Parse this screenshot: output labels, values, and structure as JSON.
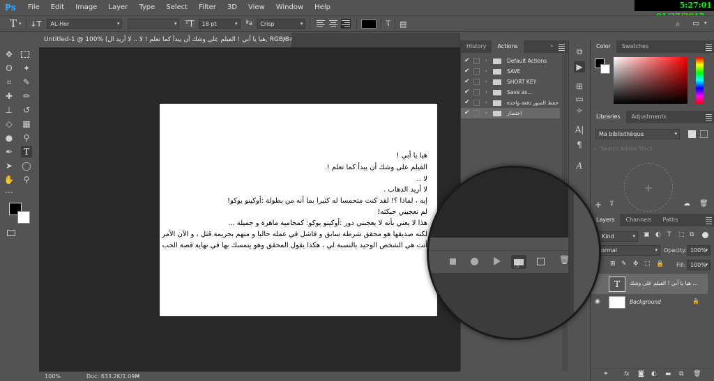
{
  "app": {
    "logo": "Ps"
  },
  "menu": [
    "File",
    "Edit",
    "Image",
    "Layer",
    "Type",
    "Select",
    "Filter",
    "3D",
    "View",
    "Window",
    "Help"
  ],
  "clock": "5:27:01 01/27/2017 م",
  "options": {
    "tool_icon": "T",
    "font_family": "AL-Hor",
    "font_style": "",
    "font_size": "18 pt",
    "antialias": "Crisp"
  },
  "document": {
    "tab_title": "Untitled-1 @ 100% (هيا يا أبي ! الفيلم على وشك أن يبدأ كما تعلم ! لا .. لا أريد ال, RGB/8#) *",
    "lines": [
      "هيا يا أبي !",
      "الفيلم على وشك أن يبدأ كما تعلم !",
      "لا ..",
      "لا أريد الذهاب .",
      "إيه ، لماذا ؟! لقد كنت متحمسا له كثيرا بما أنه من بطولة :أوكينو يوكو!",
      "لم تعجبني حبكته!",
      "هذا لا يعني بأنه لا يعجبني دور :أوكينو يوكو: كمحامية ماهرة و جميلة ...",
      "لكنه صديقها هو محقق شرطة سابق و فاشل في عمله حاليا و متهم بجريمة قتل ، و الآن الأمر متوقف على",
      "أنت هي الشخص الوحيد بالنسبة لي ، هكذا يقول المحقق وهو يتمسك بها في نهاية قصة الحب الحزينة الغامضة"
    ]
  },
  "status": {
    "zoom": "100%",
    "doc": "Doc: 633.2K/1.09M"
  },
  "actions_panel": {
    "tabs": [
      "History",
      "Actions"
    ],
    "active_tab": "Actions",
    "rows": [
      {
        "label": "Default Actions",
        "selected": false,
        "has_dialog": true
      },
      {
        "label": "SAVE",
        "selected": false,
        "has_dialog": false
      },
      {
        "label": "SHORT KEY",
        "selected": false,
        "has_dialog": false
      },
      {
        "label": "Save as...",
        "selected": false,
        "has_dialog": false
      },
      {
        "label": "حفظ الصور دفعة واحدة",
        "selected": false,
        "has_dialog": false
      },
      {
        "label": "اختصار",
        "selected": true,
        "has_dialog": false
      }
    ]
  },
  "color_panel": {
    "tabs": [
      "Color",
      "Swatches"
    ]
  },
  "libraries_panel": {
    "tabs": [
      "Libraries",
      "Adjustments"
    ],
    "library": "Ma bibliothèque",
    "search_placeholder": "Search Adobe Stock"
  },
  "layers_panel": {
    "tabs": [
      "Layers",
      "Channels",
      "Paths"
    ],
    "kind": "Kind",
    "blend": "Normal",
    "opacity_label": "Opacity:",
    "opacity": "100%",
    "fill_label": "Fill:",
    "fill": "100%",
    "layers": [
      {
        "name": "هيا يا أبي ! الفيلم على وشك ...",
        "type": "text"
      },
      {
        "name": "Background",
        "type": "background"
      }
    ]
  }
}
